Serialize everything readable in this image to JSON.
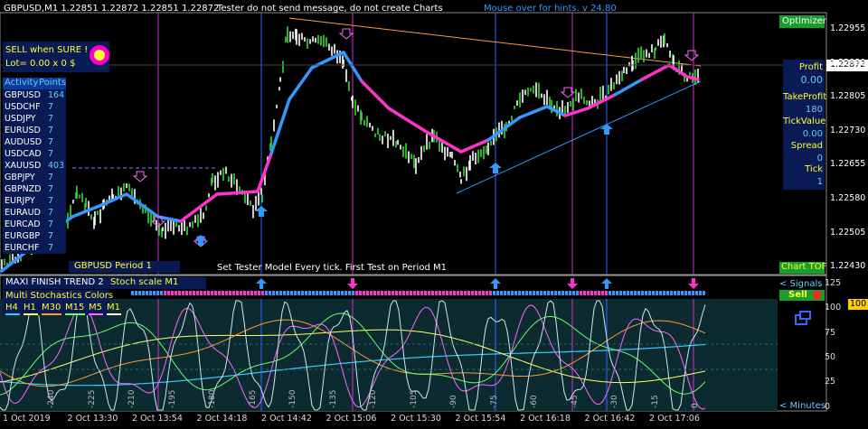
{
  "header": {
    "symbol_ohlc": "GBPUSD,M1  1.22851 1.22872 1.22851 1.22872",
    "tester_msg": "Tester do not send message, do not create Charts",
    "hint": "Mouse over for hints.   v 24.80"
  },
  "signal_box": {
    "line1": "SELL when SURE !",
    "line2": "Lot= 0.00 x 0 $"
  },
  "activity": {
    "label_activity": "Activity",
    "label_points": "Points"
  },
  "symbols": [
    {
      "name": "GBPUSD",
      "points": "164"
    },
    {
      "name": "USDCHF",
      "points": "7"
    },
    {
      "name": "USDJPY",
      "points": "7"
    },
    {
      "name": "EURUSD",
      "points": "7"
    },
    {
      "name": "AUDUSD",
      "points": "7"
    },
    {
      "name": "USDCAD",
      "points": "7"
    },
    {
      "name": "XAUUSD",
      "points": "403"
    },
    {
      "name": "GBPJPY",
      "points": "7"
    },
    {
      "name": "GBPNZD",
      "points": "7"
    },
    {
      "name": "EURJPY",
      "points": "7"
    },
    {
      "name": "EURAUD",
      "points": "7"
    },
    {
      "name": "EURCAD",
      "points": "7"
    },
    {
      "name": "EURGBP",
      "points": "7"
    },
    {
      "name": "EURCHF",
      "points": "7"
    }
  ],
  "period_label": "GBPUSD Period 1",
  "bottom_msg": "Set Tester Model Every tick. First Test on Period M1",
  "right_panel": {
    "optimizer": "Optimizer",
    "profit_label": "Profit",
    "profit_value": "0.00",
    "takeprofit_label": "TakeProfit",
    "takeprofit_value": "180",
    "tickvalue_label": "TickValue",
    "tickvalue_value": "0.00",
    "spread_label": "Spread",
    "spread_value": "0",
    "tick_label": "Tick",
    "tick_value": "1",
    "chart_tof": "Chart TOF",
    "current_price": "1.22872"
  },
  "price_axis": [
    "1.22955",
    "1.22880",
    "1.22805",
    "1.22730",
    "1.22655",
    "1.22580",
    "1.22505",
    "1.22430"
  ],
  "time_axis": [
    "1 Oct 2019",
    "2 Oct 13:30",
    "2 Oct 13:54",
    "2 Oct 14:18",
    "2 Oct 14:42",
    "2 Oct 15:06",
    "2 Oct 15:30",
    "2 Oct 15:54",
    "2 Oct 16:18",
    "2 Oct 16:42",
    "2 Oct 17:06"
  ],
  "stoch_panel": {
    "title": "MAXI FINISH TREND 2 .",
    "scale": "Stoch scale M1",
    "colors_title": "Multi Stochastics Colors",
    "tf_labels": [
      "H4",
      "H1",
      "M30",
      "M15",
      "M5",
      "M1"
    ],
    "tf_colors": [
      "#33ccff",
      "#ffff66",
      "#ff9933",
      "#66ff66",
      "#ff66ff",
      "#ffffff"
    ],
    "signals": "< Signals",
    "sell": "Sell",
    "minutes": "< Minutes",
    "level_100": "100",
    "y_ticks": [
      "125",
      "100",
      "75",
      "50",
      "25",
      "0"
    ],
    "x_ticks": [
      "-240",
      "-225",
      "-210",
      "-195",
      "-180",
      "-165",
      "-150",
      "-135",
      "-120",
      "-105",
      "-90",
      "-75",
      "-60",
      "-45",
      "-30",
      "-15",
      "0"
    ]
  },
  "colors": {
    "bull": "#33cc33",
    "bear": "#33cc33",
    "trend_blue": "#3399ff",
    "trend_magenta": "#ff33cc",
    "panel_bg": "#0a1a55",
    "optimizer_green": "#1a9e2a"
  }
}
